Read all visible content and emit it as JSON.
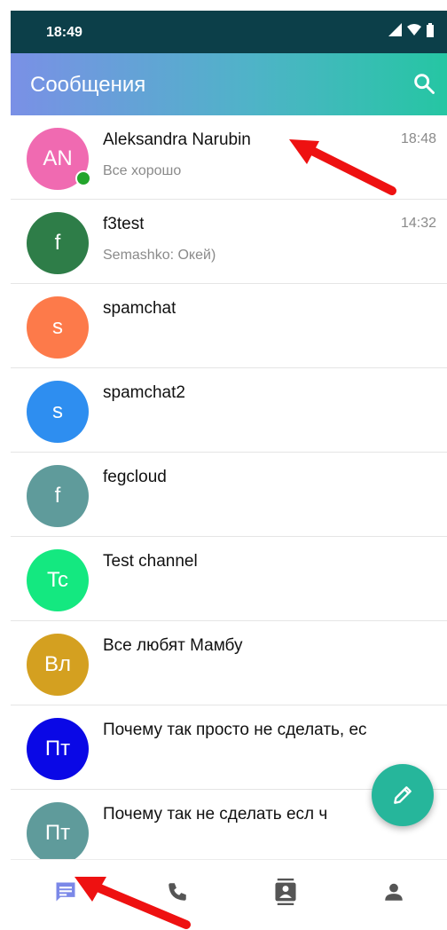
{
  "status_bar": {
    "time": "18:49"
  },
  "app_bar": {
    "title": "Сообщения"
  },
  "chats": [
    {
      "initials": "AN",
      "name": "Aleksandra Narubin",
      "preview": "Все хорошо",
      "time": "18:48",
      "color": "#f06ab1",
      "online": true
    },
    {
      "initials": "f",
      "name": "f3test",
      "preview": "Semashko: Окей)",
      "time": "14:32",
      "color": "#2e7d48",
      "online": false
    },
    {
      "initials": "s",
      "name": "spamchat",
      "preview": "",
      "time": "",
      "color": "#fd7a4a",
      "online": false
    },
    {
      "initials": "s",
      "name": "spamchat2",
      "preview": "",
      "time": "",
      "color": "#2e8ef0",
      "online": false
    },
    {
      "initials": "f",
      "name": "fegcloud",
      "preview": "",
      "time": "",
      "color": "#5f9b9b",
      "online": false
    },
    {
      "initials": "Tc",
      "name": "Test channel",
      "preview": "",
      "time": "",
      "color": "#14e880",
      "online": false
    },
    {
      "initials": "Вл",
      "name": "Все любят Мамбу",
      "preview": "",
      "time": "",
      "color": "#d4a020",
      "online": false
    },
    {
      "initials": "Пт",
      "name": "Почему так просто не сделать, ес",
      "preview": "",
      "time": "",
      "color": "#0a08e6",
      "online": false
    },
    {
      "initials": "Пт",
      "name": "Почему так не сделать есл ч",
      "preview": "",
      "time": "",
      "color": "#5f9b9b",
      "online": false
    }
  ],
  "bottom_nav": {
    "items": [
      {
        "icon": "chat-icon",
        "active": true
      },
      {
        "icon": "phone-icon",
        "active": false
      },
      {
        "icon": "contacts-icon",
        "active": false
      },
      {
        "icon": "person-icon",
        "active": false
      }
    ]
  },
  "colors": {
    "accent_fab": "#26b69b",
    "active_nav": "#7b88e8",
    "inactive_nav": "#555555",
    "annotation_arrow": "#ee1111"
  }
}
